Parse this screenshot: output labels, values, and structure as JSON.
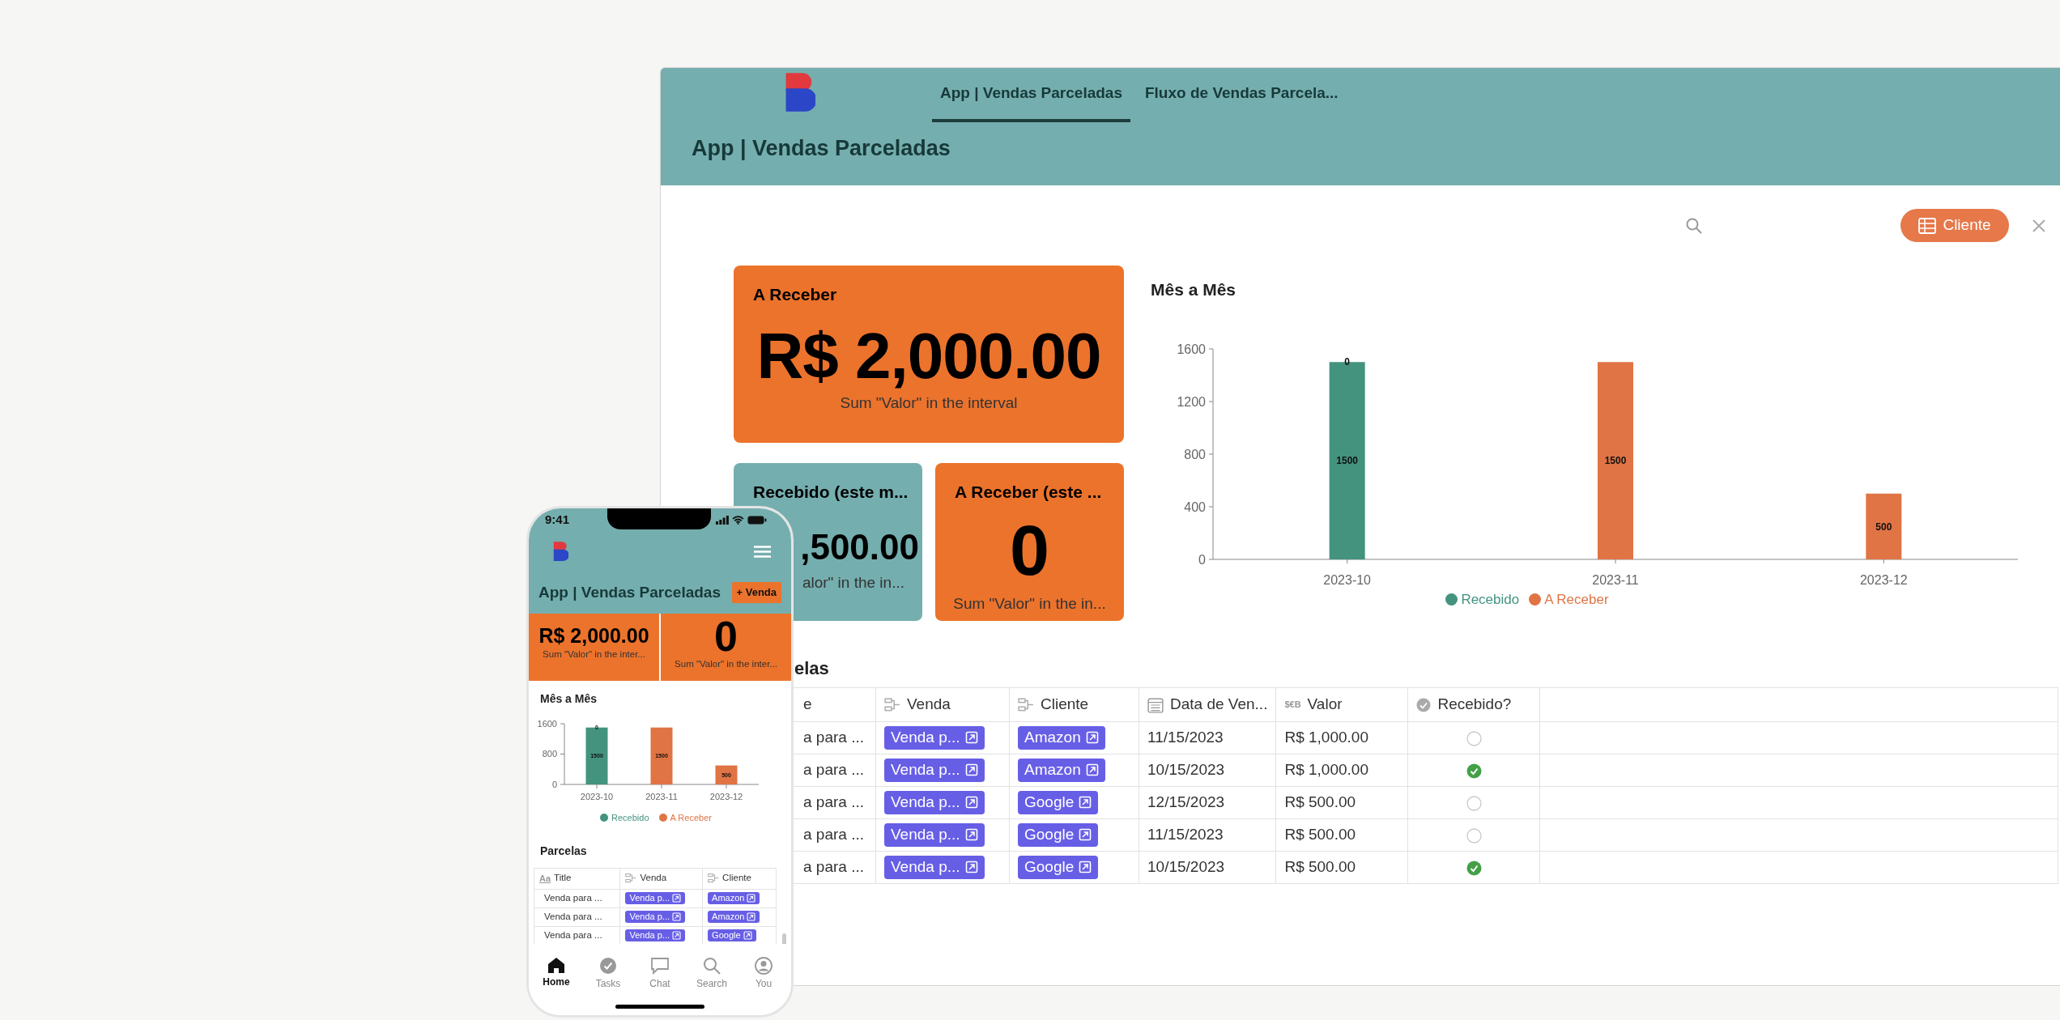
{
  "desktop": {
    "tabs": [
      {
        "label": "App | Vendas Parceladas",
        "selected": true
      },
      {
        "label": "Fluxo de Vendas Parcela...",
        "selected": false
      }
    ],
    "page_title": "App | Vendas Parceladas",
    "toolbar": {
      "button": "Cliente"
    },
    "stats": [
      {
        "title": "A Receber",
        "value": "R$ 2,000.00",
        "caption": "Sum \"Valor\" in the interval",
        "color": "#ec732c"
      },
      {
        "title": "Recebido (este m...",
        "value": ",500.00",
        "caption": "alor\" in the in...",
        "color": "#75aeae"
      },
      {
        "title": "A Receber (este ...",
        "value": "0",
        "caption": "Sum \"Valor\" in the in...",
        "color": "#ec732c"
      }
    ],
    "chart": {
      "title": "Mês a Mês",
      "chart_data": {
        "type": "bar",
        "categories": [
          "2023-10",
          "2023-11",
          "2023-12"
        ],
        "stacked": true,
        "legend": true,
        "yticks": [
          0,
          400,
          800,
          1200,
          1600
        ],
        "ylim": [
          0,
          1600
        ],
        "series": [
          {
            "name": "Recebido",
            "color": "#43937f",
            "values": [
              1500,
              0,
              0
            ],
            "value_labels": [
              "1500",
              null,
              null
            ]
          },
          {
            "name": "A Receber",
            "color": "#e07444",
            "values": [
              0,
              1500,
              500
            ],
            "value_labels": [
              "0",
              "1500",
              "500"
            ]
          }
        ]
      }
    },
    "table": {
      "title": "elas",
      "columns": [
        {
          "label": "e",
          "kind": "text"
        },
        {
          "label": "Venda",
          "kind": "relation"
        },
        {
          "label": "Cliente",
          "kind": "relation"
        },
        {
          "label": "Data de Ven...",
          "kind": "date"
        },
        {
          "label": "Valor",
          "kind": "currency",
          "icon_text": "$€B"
        },
        {
          "label": "Recebido?",
          "kind": "check"
        }
      ],
      "rows": [
        {
          "title": "a para ...",
          "venda": "Venda p...",
          "cliente": "Amazon",
          "data": "11/15/2023",
          "valor": "R$ 1,000.00",
          "recebido": false
        },
        {
          "title": "a para ...",
          "venda": "Venda p...",
          "cliente": "Amazon",
          "data": "10/15/2023",
          "valor": "R$ 1,000.00",
          "recebido": true
        },
        {
          "title": "a para ...",
          "venda": "Venda p...",
          "cliente": "Google",
          "data": "12/15/2023",
          "valor": "R$ 500.00",
          "recebido": false
        },
        {
          "title": "a para ...",
          "venda": "Venda p...",
          "cliente": "Google",
          "data": "11/15/2023",
          "valor": "R$ 500.00",
          "recebido": false
        },
        {
          "title": "a para ...",
          "venda": "Venda p...",
          "cliente": "Google",
          "data": "10/15/2023",
          "valor": "R$ 500.00",
          "recebido": true
        }
      ]
    }
  },
  "phone": {
    "status_time": "9:41",
    "title": "App | Vendas Parceladas",
    "add_button": "+ Venda",
    "stats": [
      {
        "value": "R$ 2,000.00",
        "caption": "Sum \"Valor\" in the inter..."
      },
      {
        "value": "0",
        "caption": "Sum \"Valor\" in the inter..."
      }
    ],
    "chart": {
      "title": "Mês a Mês",
      "chart_data": {
        "type": "bar",
        "categories": [
          "2023-10",
          "2023-11",
          "2023-12"
        ],
        "stacked": true,
        "legend": true,
        "yticks": [
          0,
          800,
          1600
        ],
        "ylim": [
          0,
          1600
        ],
        "series": [
          {
            "name": "Recebido",
            "color": "#43937f",
            "values": [
              1500,
              0,
              0
            ],
            "value_labels": [
              "1500",
              null,
              null
            ]
          },
          {
            "name": "A Receber",
            "color": "#e07444",
            "values": [
              0,
              1500,
              500
            ],
            "value_labels": [
              "0",
              "1500",
              "500"
            ]
          }
        ]
      }
    },
    "table": {
      "title": "Parcelas",
      "columns": [
        {
          "label": "Title",
          "kind": "text",
          "icon_text": "Aa"
        },
        {
          "label": "Venda",
          "kind": "relation"
        },
        {
          "label": "Cliente",
          "kind": "relation"
        }
      ],
      "rows": [
        [
          "Venda para ...",
          "Venda p...",
          "Amazon"
        ],
        [
          "Venda para ...",
          "Venda p...",
          "Amazon"
        ],
        [
          "Venda para ...",
          "Venda p...",
          "Google"
        ]
      ]
    },
    "nav": [
      {
        "label": "Home",
        "selected": true
      },
      {
        "label": "Tasks",
        "selected": false
      },
      {
        "label": "Chat",
        "selected": false
      },
      {
        "label": "Search",
        "selected": false
      },
      {
        "label": "You",
        "selected": false
      }
    ]
  }
}
